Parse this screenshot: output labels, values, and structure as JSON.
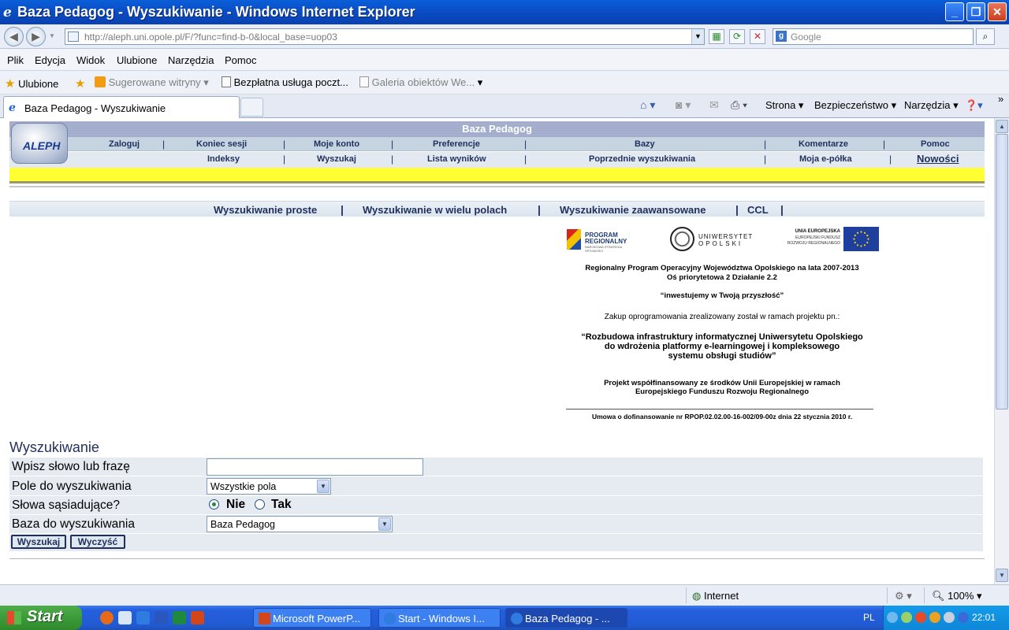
{
  "window": {
    "title": "Baza Pedagog - Wyszukiwanie - Windows Internet Explorer",
    "minimize": "_",
    "restore": "❐",
    "close": "✕"
  },
  "address_bar": {
    "url": "http://aleph.uni.opole.pl/F/?func=find-b-0&local_base=uop03",
    "search_placeholder": "Google"
  },
  "menu": [
    "Plik",
    "Edycja",
    "Widok",
    "Ulubione",
    "Narzędzia",
    "Pomoc"
  ],
  "favorites_bar": {
    "favorites": "Ulubione",
    "suggested": "Sugerowane witryny",
    "free_mail": "Bezpłatna usługa poczt...",
    "gallery": "Galeria obiektów We..."
  },
  "tab": {
    "title": "Baza Pedagog - Wyszukiwanie"
  },
  "command_bar": {
    "page": "Strona",
    "security": "Bezpieczeństwo",
    "tools": "Narzędzia"
  },
  "aleph": {
    "logo_text": "ALEPH",
    "db_title": "Baza Pedagog",
    "nav_row1": [
      "Zaloguj",
      "Koniec sesji",
      "Moje konto",
      "Preferencje",
      "Bazy",
      "Komentarze",
      "Pomoc"
    ],
    "nav_row2": [
      "Indeksy",
      "Wyszukaj",
      "Lista wyników",
      "Poprzednie wyszukiwania",
      "Moja e-półka",
      "Nowości"
    ],
    "search_tabs": [
      "Wyszukiwanie proste",
      "Wyszukiwanie w wielu polach",
      "Wyszukiwanie zaawansowane",
      "CCL"
    ]
  },
  "eu_block": {
    "logo_program_line1": "PROGRAM",
    "logo_program_line2": "REGIONALNY",
    "logo_program_line3": "NARODOWA STRATEGIA SPÓJNOŚCI",
    "logo_univ_line1": "UNIWERSYTET",
    "logo_univ_line2": "OPOLSKI",
    "logo_eu_line1": "UNIA EUROPEJSKA",
    "logo_eu_line2": "EUROPEJSKI FUNDUSZ",
    "logo_eu_line3": "ROZWOJU REGIONALNEGO",
    "program_line": "Regionalny Program Operacyjny Województwa Opolskiego na lata 2007-2013",
    "axis_line": "Oś priorytetowa 2   Działanie 2.2",
    "slogan": "“inwestujemy w Twoją przyszłość”",
    "purchase": "Zakup oprogramowania zrealizowany został w ramach projektu pn.:",
    "project_1": "“Rozbudowa infrastruktury informatycznej Uniwersytetu Opolskiego",
    "project_2": "do wdrożenia platformy e-learningowej i kompleksowego",
    "project_3": "systemu obsługi studiów”",
    "cofinanced_1": "Projekt współfinansowany ze środków Unii Europejskiej w ramach",
    "cofinanced_2": "Europejskiego Funduszu Rozwoju Regionalnego",
    "agreement": "Umowa o dofinansowanie nr RPOP.02.02.00-16-002/09-00z dnia 22 stycznia 2010 r."
  },
  "form": {
    "title": "Wyszukiwanie",
    "phrase_label": "Wpisz słowo lub frazę",
    "phrase_value": "",
    "field_label": "Pole do wyszukiwania",
    "field_value": "Wszystkie pola",
    "adjacent_label": "Słowa sąsiadujące?",
    "adjacent_no": "Nie",
    "adjacent_yes": "Tak",
    "adjacent_selected": "Nie",
    "base_label": "Baza do wyszukiwania",
    "base_value": "Baza Pedagog",
    "search_button": "Wyszukaj",
    "clear_button": "Wyczyść"
  },
  "status_bar": {
    "zone": "Internet",
    "zoom": "100%"
  },
  "taskbar": {
    "start": "Start",
    "tasks": [
      "Microsoft PowerP...",
      "Start - Windows I...",
      "Baza Pedagog - ..."
    ],
    "language": "PL",
    "clock": "22:01"
  }
}
